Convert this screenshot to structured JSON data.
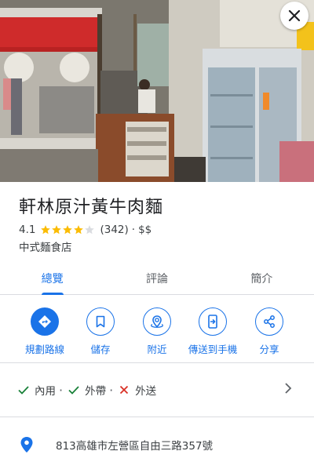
{
  "place": {
    "name": "軒林原汁黃牛肉麵",
    "rating": "4.1",
    "stars_filled": 4,
    "review_count": "(342)",
    "price_sep": "·",
    "price_level": "$$",
    "category": "中式麵食店"
  },
  "tabs": [
    {
      "label": "總覽",
      "active": true
    },
    {
      "label": "評論",
      "active": false
    },
    {
      "label": "簡介",
      "active": false
    }
  ],
  "actions": [
    {
      "label": "規劃路線",
      "icon": "directions-icon"
    },
    {
      "label": "儲存",
      "icon": "bookmark-icon"
    },
    {
      "label": "附近",
      "icon": "nearby-icon"
    },
    {
      "label": "傳送到手機",
      "icon": "send-to-phone-icon"
    },
    {
      "label": "分享",
      "icon": "share-icon"
    }
  ],
  "services": [
    {
      "label": "內用",
      "available": true,
      "sep": "·"
    },
    {
      "label": "外帶",
      "available": true,
      "sep": "·"
    },
    {
      "label": "外送",
      "available": false,
      "sep": ""
    }
  ],
  "address": "813高雄市左營區自由三路357號",
  "colors": {
    "accent": "#1a73e8",
    "star": "#fbbc04",
    "check": "#188038",
    "cross": "#d93025"
  }
}
